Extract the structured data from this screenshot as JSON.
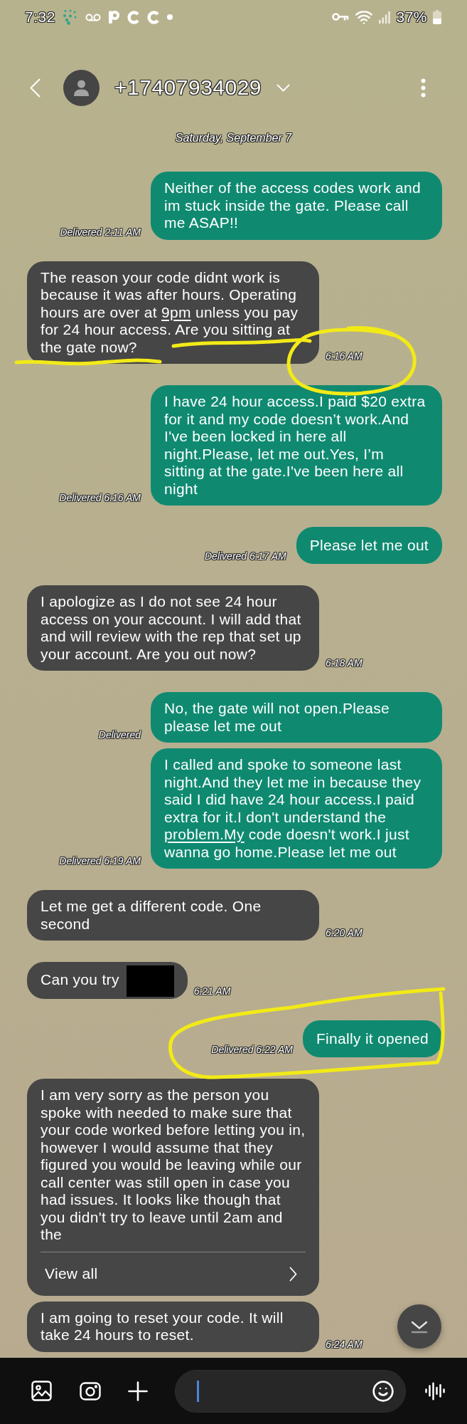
{
  "status_bar": {
    "time": "7:32",
    "battery": "37%"
  },
  "header": {
    "contact": "+17407934029"
  },
  "date_divider": "Saturday, September 7",
  "message_groups": [
    {
      "kind": "sent",
      "messages": [
        {
          "text": "Neither of the access codes work and im stuck inside the gate. Please call me ASAP!!",
          "meta": "Delivered 2:11 AM"
        }
      ]
    },
    {
      "kind": "received",
      "messages": [
        {
          "parts": [
            {
              "kind": "text",
              "text": "The reason your code didnt work is because it was after hours. Operating hours are over at "
            },
            {
              "kind": "link",
              "text": "9pm"
            },
            {
              "kind": "text",
              "text": " unless you pay for 24 hour access. Are you sitting at the gate now?"
            }
          ],
          "meta": "6:16 AM",
          "underline_marked": true,
          "time_circled": true
        }
      ]
    },
    {
      "kind": "sent",
      "messages": [
        {
          "text": "I have 24 hour access.I paid $20 extra for it and my code doesn’t work.And I've been locked in here all night.Please, let me out.Yes, I’m sitting at the gate.I've been here all night",
          "meta": "Delivered 6:16 AM"
        }
      ]
    },
    {
      "kind": "sent",
      "messages": [
        {
          "text": "Please let me out",
          "meta": "Delivered 6:17 AM"
        }
      ]
    },
    {
      "kind": "received",
      "messages": [
        {
          "text": "I apologize as I do not see 24 hour access on your account. I will add that and will review with the rep that set up your account. Are you out now?",
          "meta": "6:18 AM"
        }
      ]
    },
    {
      "kind": "sent",
      "messages": [
        {
          "text": "No, the gate will not open.Please please let me out",
          "meta": "Delivered"
        },
        {
          "parts": [
            {
              "kind": "text",
              "text": "I called and spoke to someone last night.And they let me in because they said I did have 24 hour access.I paid extra for it.I don't understand the "
            },
            {
              "kind": "link",
              "text": "problem.My"
            },
            {
              "kind": "text",
              "text": " code doesn't work.I just wanna go home.Please let me out"
            }
          ],
          "meta": "Delivered 6:19 AM"
        }
      ]
    },
    {
      "kind": "received",
      "messages": [
        {
          "text": "Let me get a different code. One second",
          "meta": "6:20 AM"
        }
      ]
    },
    {
      "kind": "received",
      "messages": [
        {
          "parts": [
            {
              "kind": "text",
              "text": "Can you try"
            },
            {
              "kind": "redaction"
            }
          ],
          "meta": "6:21 AM"
        }
      ]
    },
    {
      "kind": "sent",
      "messages": [
        {
          "text": "Finally it opened",
          "meta": "Delivered 6:22 AM",
          "circled": true
        }
      ]
    },
    {
      "kind": "received",
      "messages": [
        {
          "text": "I am very sorry as the person you spoke with needed to make sure that your code worked before letting you in, however I would assume that they figured you would be leaving while our call center was still open in case you had issues. It looks like though that you didn't try to leave until 2am and the",
          "view_all": "View all"
        },
        {
          "text": "I am going to reset your code. It will take 24 hours to reset.",
          "meta": "6:24 AM"
        }
      ]
    }
  ],
  "composer": {
    "input": {
      "focused": true
    }
  }
}
